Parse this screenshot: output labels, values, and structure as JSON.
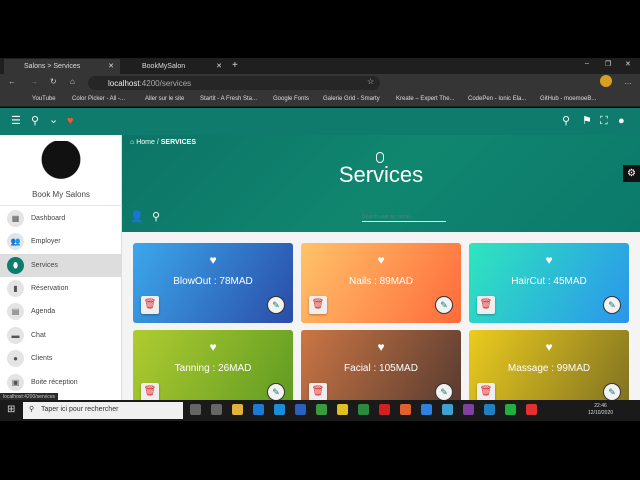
{
  "browser": {
    "tabs": [
      {
        "label": "Salons > Services",
        "active": true
      },
      {
        "label": "BookMySalon",
        "active": false
      }
    ],
    "url_host": "localhost",
    "url_path": ":4200/services",
    "bookmarks": [
      "YouTube",
      "Color Picker - All -...",
      "Aller sur le site",
      "Startit - A Fresh Sta...",
      "Google Fonts",
      "Galerie Grid - Smarty",
      "Kreate – Expert The...",
      "CodePen - Ionic Ela...",
      "GitHub - moemoeB..."
    ],
    "status_url": "localhost:4200/services"
  },
  "sidebar": {
    "brand": "Book My Salons",
    "items": [
      {
        "label": "Dashboard",
        "icon": "dashboard-icon"
      },
      {
        "label": "Employer",
        "icon": "people-icon"
      },
      {
        "label": "Services",
        "icon": "mouse-icon",
        "selected": true
      },
      {
        "label": "Réservation",
        "icon": "book-icon"
      },
      {
        "label": "Agenda",
        "icon": "calendar-icon"
      },
      {
        "label": "Chat",
        "icon": "chat-icon"
      },
      {
        "label": "Clients",
        "icon": "person-icon"
      },
      {
        "label": "Boite réception",
        "icon": "inbox-icon"
      }
    ]
  },
  "breadcrumb": {
    "home": "Home",
    "sep": "/",
    "current": "SERVICES"
  },
  "page_title": "Services",
  "search": {
    "placeholder": "Search user by name..."
  },
  "cards": [
    {
      "title": "BlowOut : 78MAD",
      "from": "#3ca8ec",
      "to": "#2a4ca8"
    },
    {
      "title": "Nails : 89MAD",
      "from": "#ffc36a",
      "to": "#ff6a3a"
    },
    {
      "title": "HairCut : 45MAD",
      "from": "#2ee6bd",
      "to": "#2b95ec"
    },
    {
      "title": "Tanning : 26MAD",
      "from": "#b0cc30",
      "to": "#5e9a22"
    },
    {
      "title": "Facial : 105MAD",
      "from": "#cc7644",
      "to": "#553a30"
    },
    {
      "title": "Massage : 99MAD",
      "from": "#eccc1e",
      "to": "#7e7022"
    }
  ],
  "taskbar": {
    "search_placeholder": "Taper ici pour rechercher",
    "time": "22:46",
    "date": "12/10/2020"
  },
  "colors": {
    "primary": "#0f7b6c",
    "accent_heart": "#ff5722",
    "delete": "#e02a2a"
  }
}
